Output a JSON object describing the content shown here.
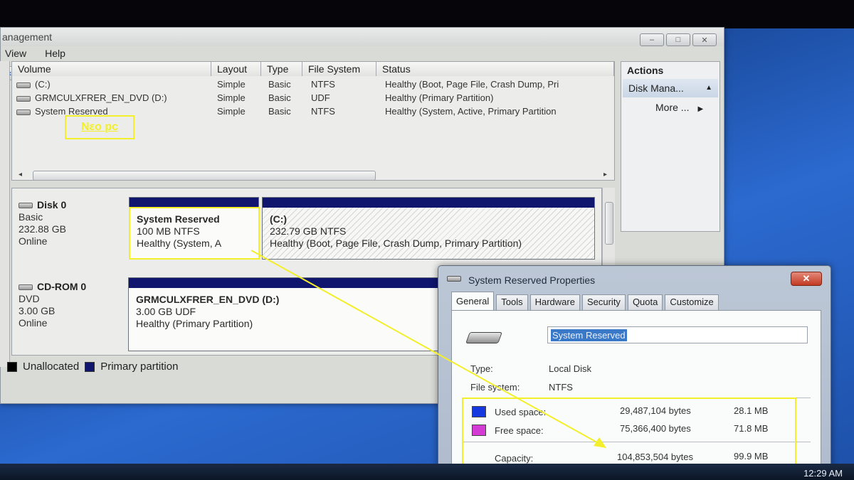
{
  "main_window": {
    "title": "anagement",
    "menu": [
      "View",
      "Help"
    ],
    "window_buttons": [
      "–",
      "□",
      "✕"
    ],
    "volume_columns": [
      "Volume",
      "Layout",
      "Type",
      "File System",
      "Status"
    ],
    "volumes": [
      {
        "volume": "(C:)",
        "layout": "Simple",
        "type": "Basic",
        "fs": "NTFS",
        "status": "Healthy (Boot, Page File, Crash Dump, Pri"
      },
      {
        "volume": "GRMCULXFRER_EN_DVD (D:)",
        "layout": "Simple",
        "type": "Basic",
        "fs": "UDF",
        "status": "Healthy (Primary Partition)"
      },
      {
        "volume": "System Reserved",
        "layout": "Simple",
        "type": "Basic",
        "fs": "NTFS",
        "status": "Healthy (System, Active, Primary Partition"
      }
    ],
    "annotation_neo": "Nεo pc",
    "disks": [
      {
        "name": "Disk 0",
        "kind": "Basic",
        "size": "232.88 GB",
        "state": "Online",
        "partitions": [
          {
            "name": "System Reserved",
            "detail": "100 MB NTFS",
            "status": "Healthy (System, A"
          },
          {
            "name": "(C:)",
            "detail": "232.79 GB NTFS",
            "status": "Healthy (Boot, Page File, Crash Dump, Primary Partition)"
          }
        ]
      },
      {
        "name": "CD-ROM 0",
        "kind": "DVD",
        "size": "3.00 GB",
        "state": "Online",
        "partitions": [
          {
            "name": "GRMCULXFRER_EN_DVD  (D:)",
            "detail": "3.00 GB UDF",
            "status": "Healthy (Primary Partition)"
          }
        ]
      }
    ],
    "legend": [
      {
        "label": "Unallocated",
        "color": "#000000"
      },
      {
        "label": "Primary partition",
        "color": "#10156e"
      }
    ],
    "actions": {
      "title": "Actions",
      "sub": "Disk Mana...",
      "more": "More ..."
    }
  },
  "properties_dialog": {
    "title": "System Reserved Properties",
    "close": "✕",
    "tabs": [
      "General",
      "Tools",
      "Hardware",
      "Security",
      "Quota",
      "Customize"
    ],
    "active_tab": "General",
    "name_value": "System Reserved",
    "type_label": "Type:",
    "type_value": "Local Disk",
    "fs_label": "File system:",
    "fs_value": "NTFS",
    "used": {
      "label": "Used space:",
      "bytes": "29,487,104 bytes",
      "size": "28.1 MB",
      "color": "#1538e0"
    },
    "free": {
      "label": "Free space:",
      "bytes": "75,366,400 bytes",
      "size": "71.8 MB",
      "color": "#d43ad4"
    },
    "capacity": {
      "label": "Capacity:",
      "bytes": "104,853,504 bytes",
      "size": "99.9 MB"
    }
  },
  "taskbar": {
    "clock": "12:29 AM"
  },
  "colors": {
    "annotation": "#f3ef2a",
    "partition_bar": "#10156e"
  }
}
